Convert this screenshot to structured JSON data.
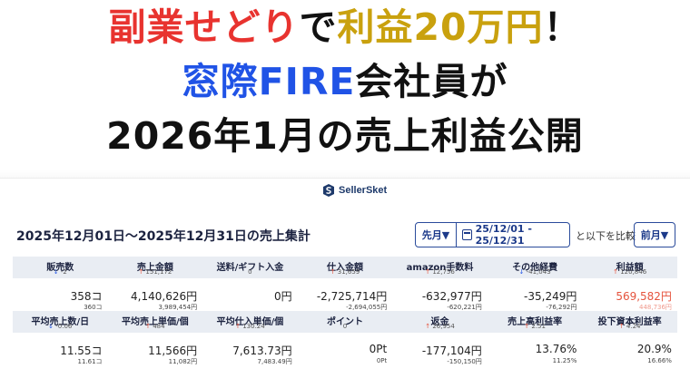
{
  "banner": {
    "line1": [
      {
        "text": "副業せどり",
        "color": "red"
      },
      {
        "text": "で",
        "color": "black"
      },
      {
        "text": "利益20万円",
        "color": "gold"
      },
      {
        "text": "！",
        "color": "black"
      }
    ],
    "line2": [
      {
        "text": "窓際FIRE",
        "color": "blue"
      },
      {
        "text": "会社員が",
        "color": "black"
      }
    ],
    "line3": "2026年1月の売上利益公開"
  },
  "brand": "SellerSket",
  "heading": "2025年12月01日〜2025年12月31日の売上集計",
  "controls": {
    "period": "先月▼",
    "date_range": "25/12/01 - 25/12/31",
    "compare_text": "と以下を比較",
    "compare_period": "前月▼"
  },
  "colors": {
    "red": "#e8332f",
    "gold": "#c9a10e",
    "blue": "#2053e6",
    "up": "#e5533d",
    "down": "#2053e6"
  },
  "metrics_row1": [
    {
      "label": "販売数",
      "dir": "down",
      "change": "-2",
      "value": "358コ",
      "prev": "360コ"
    },
    {
      "label": "売上金額",
      "dir": "up",
      "change": "151,172",
      "value": "4,140,626円",
      "prev": "3,989,454円"
    },
    {
      "label": "送料/ギフト入金",
      "dir": "none",
      "change": "0",
      "value": "0円",
      "prev": ""
    },
    {
      "label": "仕入金額",
      "dir": "up",
      "change": "31,659",
      "value": "-2,725,714円",
      "prev": "-2,694,055円"
    },
    {
      "label": "amazon手数料",
      "dir": "up",
      "change": "12,756",
      "value": "-632,977円",
      "prev": "-620,221円"
    },
    {
      "label": "その他経費",
      "dir": "down",
      "change": "-41,043",
      "value": "-35,249円",
      "prev": "-76,292円"
    },
    {
      "label": "利益額",
      "dir": "up",
      "change": "120,846",
      "value": "569,582円",
      "prev": "448,736円",
      "highlight": true
    }
  ],
  "metrics_row2": [
    {
      "label": "平均売上数/日",
      "dir": "down",
      "change": "-0.06",
      "value": "11.55コ",
      "prev": "11.61コ"
    },
    {
      "label": "平均売上単価/個",
      "dir": "up",
      "change": "484",
      "value": "11,566円",
      "prev": "11,082円"
    },
    {
      "label": "平均仕入単価/個",
      "dir": "up",
      "change": "130.24",
      "value": "7,613.73円",
      "prev": "7,483.49円"
    },
    {
      "label": "ポイント",
      "dir": "none",
      "change": "0",
      "value": "0Pt",
      "prev": "0Pt"
    },
    {
      "label": "返金",
      "dir": "up",
      "change": "26,954",
      "value": "-177,104円",
      "prev": "-150,150円"
    },
    {
      "label": "売上高利益率",
      "dir": "up",
      "change": "2.51",
      "value": "13.76%",
      "prev": "11.25%"
    },
    {
      "label": "投下資本利益率",
      "dir": "up",
      "change": "4.24",
      "value": "20.9%",
      "prev": "16.66%"
    }
  ]
}
